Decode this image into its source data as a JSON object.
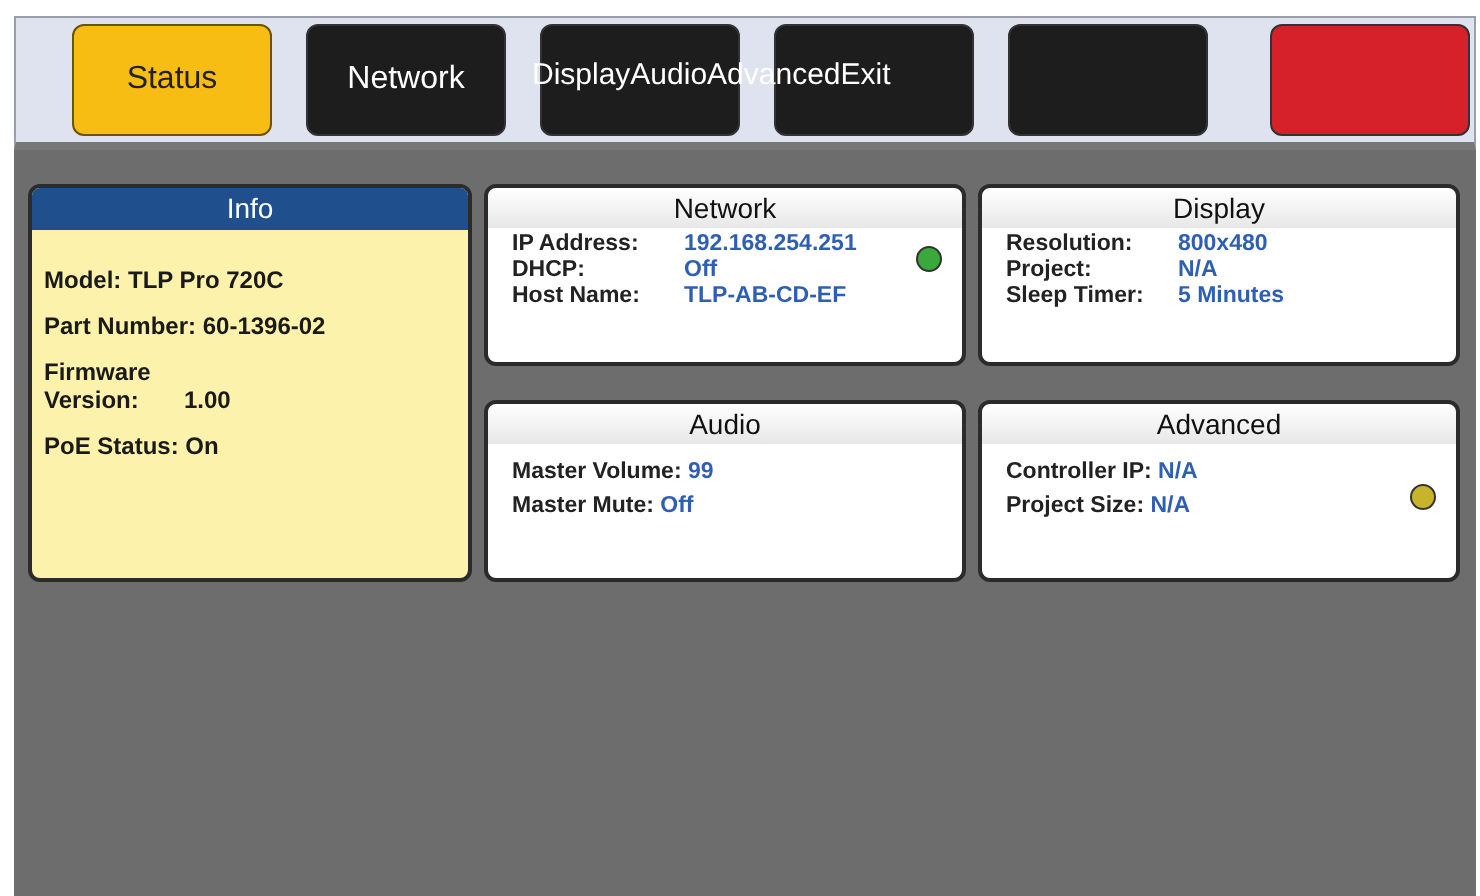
{
  "tabs": [
    {
      "kind": "tab",
      "label": "Status",
      "selected": true
    },
    {
      "kind": "tab",
      "label": "Network",
      "selected": false
    },
    {
      "kind": "tab",
      "selected": false
    },
    {
      "kind": "tab",
      "selected": false
    },
    {
      "kind": "tab",
      "selected": false
    },
    {
      "kind": "exit",
      "selected": false
    }
  ],
  "overflow_label": "DisplayAudioAdvancedExit",
  "info": {
    "title": "Info",
    "items": [
      {
        "kind": "line",
        "text": "Model: TLP Pro 720C"
      },
      {
        "kind": "line",
        "text": "Part Number: 60-1396-02"
      },
      {
        "kind": "pair",
        "label": "Firmware Version:",
        "value": "1.00"
      },
      {
        "kind": "line",
        "text": "PoE Status: On"
      }
    ]
  },
  "panels": [
    {
      "title": "Network",
      "color": "#3aa83a",
      "label_col": true,
      "rows": [
        {
          "label": "IP Address:",
          "value": "192.168.254.251"
        },
        {
          "label": "DHCP:",
          "value": "Off"
        },
        {
          "label": "Host Name:",
          "value": "TLP-AB-CD-EF"
        }
      ]
    },
    {
      "title": "Display",
      "label_col": true,
      "rows": [
        {
          "label": "Resolution:",
          "value": "800x480"
        },
        {
          "label": "Project:",
          "value": "N/A"
        },
        {
          "label": "Sleep Timer:",
          "value": "5 Minutes"
        }
      ]
    },
    {
      "title": "Audio",
      "label_col": false,
      "rows": [
        {
          "label": "Master Volume:",
          "value": "99"
        },
        {
          "label": "Master Mute:",
          "value": "Off"
        }
      ]
    },
    {
      "title": "Advanced",
      "color": "#c8b42a",
      "label_col": false,
      "rows": [
        {
          "label": "Controller IP:",
          "value": "N/A"
        },
        {
          "label": "Project Size:",
          "value": "N/A"
        }
      ]
    }
  ]
}
